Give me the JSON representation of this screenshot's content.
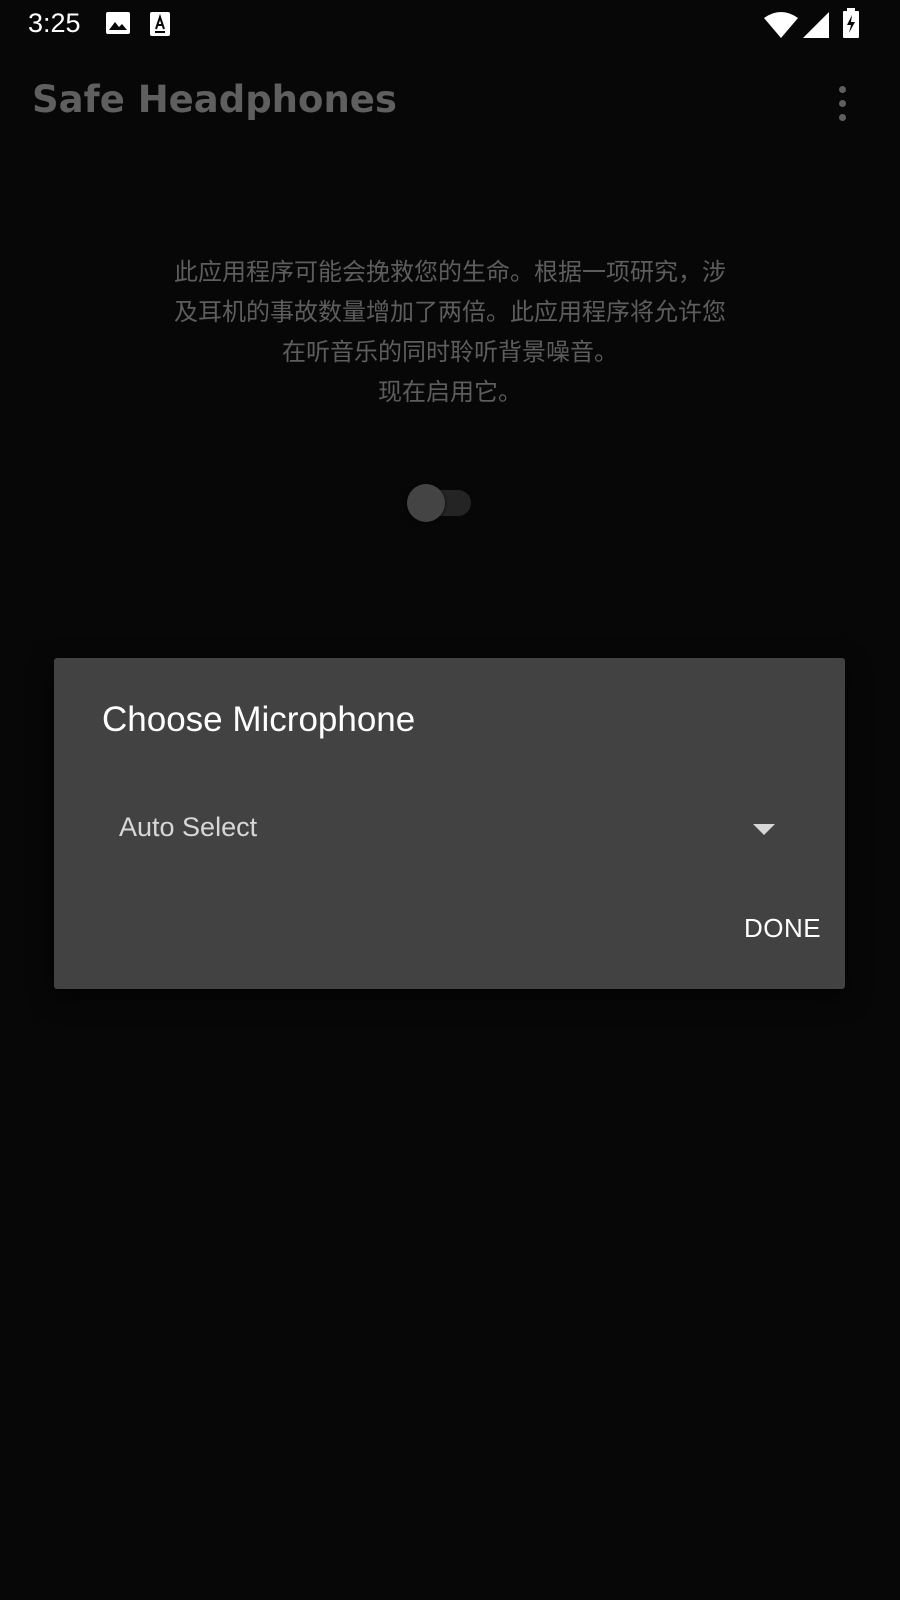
{
  "status_bar": {
    "time": "3:25",
    "icons": [
      "image-icon",
      "text-a-icon",
      "wifi-icon",
      "cell-signal-icon",
      "battery-charging-icon"
    ]
  },
  "app_bar": {
    "title": "Safe Headphones",
    "menu_icon": "overflow-menu-icon"
  },
  "description": {
    "lines": [
      "此应用程序可能会挽救您的生命。根据一项研究，涉",
      "及耳机的事故数量增加了两倍。此应用程序将允许您",
      "在听音乐的同时聆听背景噪音。",
      "现在启用它。"
    ]
  },
  "toggle": {
    "state": "off"
  },
  "dialog": {
    "title": "Choose Microphone",
    "spinner_value": "Auto Select",
    "done_label": "DONE"
  },
  "colors": {
    "background": "#070707",
    "dialog_bg": "#424242",
    "muted_text": "#5d5d5d"
  }
}
